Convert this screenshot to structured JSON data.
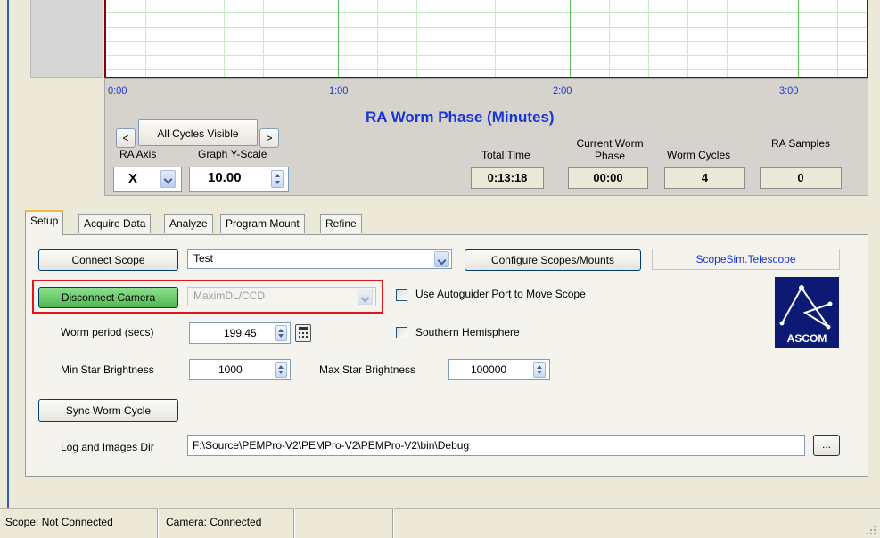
{
  "graph": {
    "x_ticks": [
      "0:00",
      "1:00",
      "2:00",
      "3:00"
    ],
    "title": "RA Worm Phase (Minutes)"
  },
  "controls": {
    "prev_label": "<",
    "cycles_label": "All Cycles Visible",
    "next_label": ">",
    "ra_axis_label": "RA Axis",
    "ra_axis_value": "X",
    "graph_yscale_label": "Graph Y-Scale",
    "graph_yscale_value": "10.00"
  },
  "stats": {
    "total_time_label": "Total Time",
    "total_time_value": "0:13:18",
    "current_worm_phase_label": "Current Worm Phase",
    "current_worm_phase_value": "00:00",
    "worm_cycles_label": "Worm Cycles",
    "worm_cycles_value": "4",
    "ra_samples_label": "RA Samples",
    "ra_samples_value": "0"
  },
  "tabs": [
    "Setup",
    "Acquire Data",
    "Analyze",
    "Program Mount",
    "Refine"
  ],
  "setup": {
    "connect_scope_label": "Connect Scope",
    "scope_select_value": "Test",
    "configure_label": "Configure Scopes/Mounts",
    "scope_driver": "ScopeSim.Telescope",
    "disconnect_camera_label": "Disconnect Camera",
    "camera_select_value": "MaximDL/CCD",
    "autoguider_label": "Use Autoguider Port to Move Scope",
    "worm_period_label": "Worm period (secs)",
    "worm_period_value": "199.45",
    "southern_label": "Southern Hemisphere",
    "min_star_label": "Min Star Brightness",
    "min_star_value": "1000",
    "max_star_label": "Max Star Brightness",
    "max_star_value": "100000",
    "sync_label": "Sync Worm Cycle",
    "log_dir_label": "Log and Images Dir",
    "log_dir_value": "F:\\Source\\PEMPro-V2\\PEMPro-V2\\PEMPro-V2\\bin\\Debug",
    "browse_label": "..."
  },
  "ascom": {
    "logo_text": "ASCOM"
  },
  "status": {
    "scope": "Scope: Not Connected",
    "camera": "Camera: Connected"
  },
  "colors": {
    "graph_border": "#8b0000",
    "graph_title": "#1a35d6",
    "connected_button": "#5cc25c",
    "highlight": "#e4141b"
  }
}
